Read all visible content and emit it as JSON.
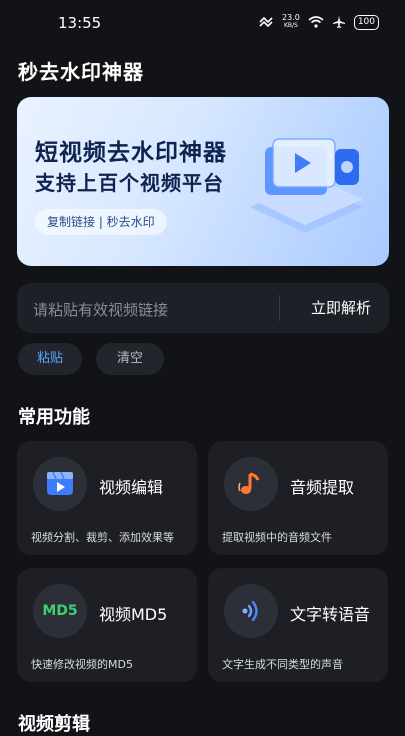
{
  "status_bar": {
    "time": "13:55",
    "net_speed": "23.0",
    "net_unit": "KB/S",
    "battery": "100"
  },
  "app": {
    "title": "秒去水印神器"
  },
  "banner": {
    "headline": "短视频去水印神器",
    "subline": "支持上百个视频平台",
    "pill": "复制链接 | 秒去水印"
  },
  "link_input": {
    "placeholder": "请粘贴有效视频链接",
    "parse_label": "立即解析"
  },
  "actions": {
    "paste": "粘贴",
    "clear": "清空"
  },
  "section": {
    "title": "常用功能"
  },
  "features": [
    {
      "title": "视频编辑",
      "desc": "视频分割、裁剪、添加效果等",
      "icon": "video-edit-icon"
    },
    {
      "title": "音频提取",
      "desc": "提取视频中的音频文件",
      "icon": "music-note-icon"
    },
    {
      "title": "视频MD5",
      "desc": "快速修改视频的MD5",
      "icon": "md5-icon",
      "icon_text": "MD5"
    },
    {
      "title": "文字转语音",
      "desc": "文字生成不同类型的声音",
      "icon": "sound-wave-icon"
    }
  ],
  "bottom_section": {
    "title": "视频剪辑"
  },
  "colors": {
    "background": "#121317",
    "card": "#1d1f25",
    "accent_blue": "#5ea4ff",
    "orange": "#ff7a2e",
    "md5_green": "#3bd16f"
  }
}
